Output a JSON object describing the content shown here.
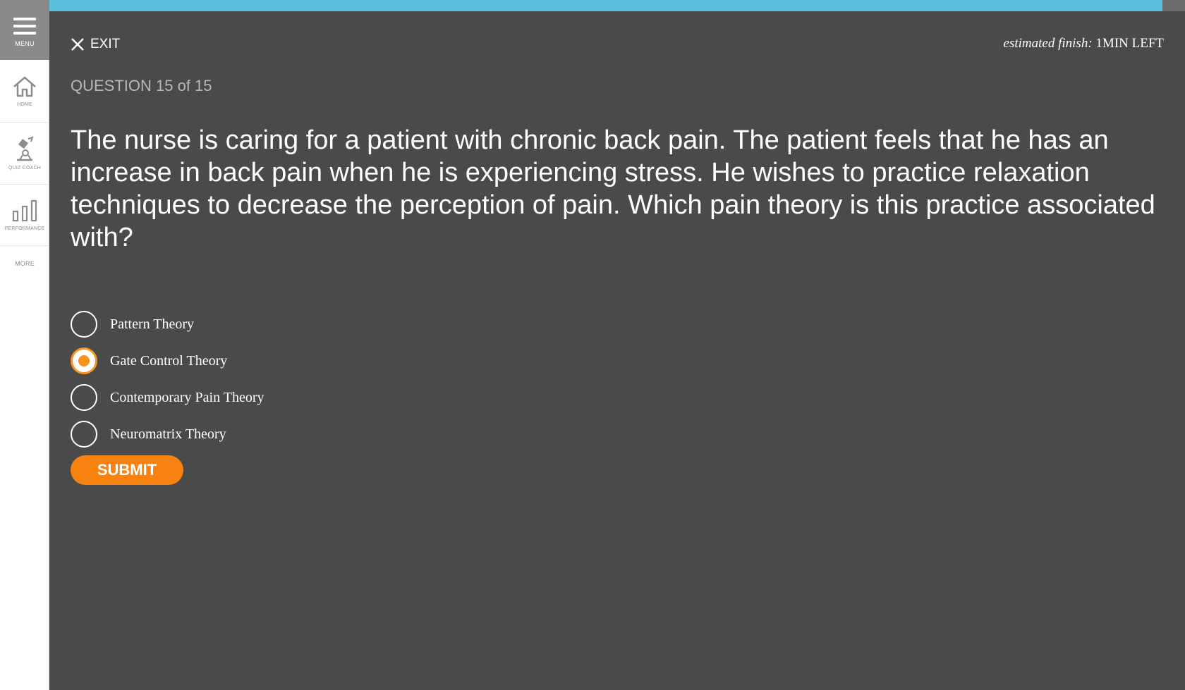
{
  "sidebar": {
    "menu_label": "MENU",
    "items": [
      {
        "label": "HOME",
        "icon": "home-icon"
      },
      {
        "label": "QUIZ COACH",
        "icon": "quiz-coach-icon"
      },
      {
        "label": "PERFORMANCE",
        "icon": "bar-chart-icon"
      },
      {
        "label": "MORE"
      }
    ]
  },
  "progress": {
    "fraction": 0.98
  },
  "header": {
    "exit_label": "EXIT",
    "estimate_label": "estimated finish:",
    "estimate_value": "1MIN LEFT"
  },
  "question": {
    "counter": "QUESTION 15 of 15",
    "text": "The nurse is caring for a patient with chronic back pain. The patient feels that he has an increase in back pain when he is experiencing stress. He wishes to practice relaxation techniques to decrease the perception of pain. Which pain theory is this practice associated with?"
  },
  "options": [
    {
      "label": "Pattern Theory",
      "selected": false
    },
    {
      "label": "Gate Control Theory",
      "selected": true
    },
    {
      "label": "Contemporary Pain Theory",
      "selected": false
    },
    {
      "label": "Neuromatrix Theory",
      "selected": false
    }
  ],
  "submit_label": "SUBMIT",
  "colors": {
    "accent": "#f7820f",
    "progress": "#5bc0de",
    "background": "#4a4a4a"
  }
}
